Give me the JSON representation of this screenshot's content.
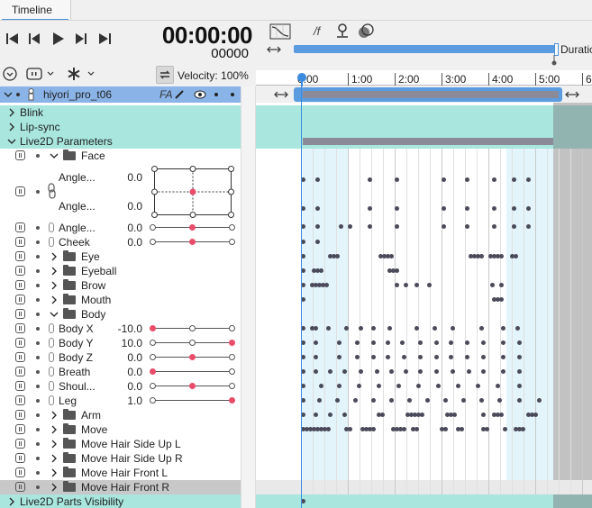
{
  "tab": {
    "label": "Timeline"
  },
  "transport": {
    "time": "00:00:00",
    "frames": "00000"
  },
  "controls": {
    "velocity_label": "Velocity:",
    "velocity_value": "100%"
  },
  "toolbar": {
    "fx_label": "/f"
  },
  "ruler": {
    "ticks": [
      "0:00",
      "1:00",
      "2:00",
      "3:00",
      "4:00",
      "5:00",
      "6"
    ],
    "duration_label": "Duration"
  },
  "model": {
    "name": "hiyori_pro_t06",
    "badge": "FA"
  },
  "groups": {
    "blink": "Blink",
    "lipsync": "Lip-sync",
    "params": "Live2D Parameters",
    "parts": "Live2D Parts Visibility"
  },
  "folders": {
    "face": "Face",
    "eye": "Eye",
    "eyeball": "Eyeball",
    "brow": "Brow",
    "mouth": "Mouth",
    "body": "Body",
    "arm": "Arm",
    "move": "Move",
    "hair_side_up_l": "Move Hair Side Up L",
    "hair_side_up_r": "Move Hair Side Up R",
    "hair_front_l": "Move Hair Front L",
    "hair_front_r": "Move Hair Front R"
  },
  "params": {
    "angle_xy": {
      "label1": "Angle...",
      "value1": "0.0",
      "label2": "Angle...",
      "value2": "0.0"
    },
    "angle_z": {
      "label": "Angle...",
      "value": "0.0"
    },
    "cheek": {
      "label": "Cheek",
      "value": "0.0"
    },
    "body_x": {
      "label": "Body X",
      "value": "-10.0"
    },
    "body_y": {
      "label": "Body Y",
      "value": "10.0"
    },
    "body_z": {
      "label": "Body Z",
      "value": "0.0"
    },
    "breath": {
      "label": "Breath",
      "value": "0.0"
    },
    "shoulder": {
      "label": "Shoul...",
      "value": "0.0"
    },
    "leg": {
      "label": "Leg",
      "value": "1.0"
    }
  },
  "colors": {
    "accent": "#4a90d9",
    "track_highlight": "#a8e6de",
    "selected_row": "#8ab4e8",
    "keyframe": "#4a4a5a",
    "knob_active": "#e94d6a"
  }
}
